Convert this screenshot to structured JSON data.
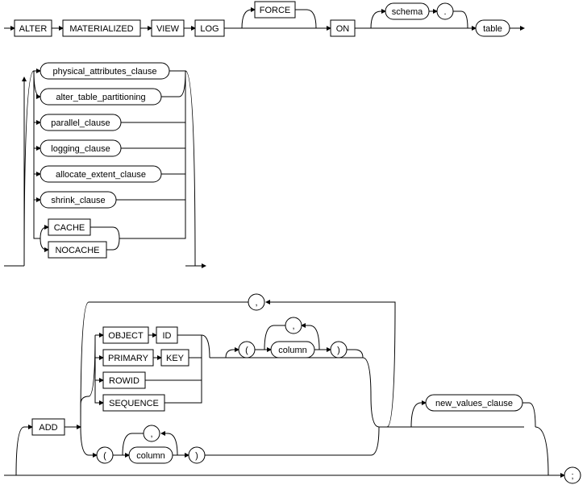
{
  "row1": {
    "alter": "ALTER",
    "materialized": "MATERIALIZED",
    "view": "VIEW",
    "log": "LOG",
    "force": "FORCE",
    "on": "ON",
    "schema": "schema",
    "dot": ".",
    "table": "table"
  },
  "block2": {
    "physical_attributes_clause": "physical_attributes_clause",
    "alter_table_partitioning": "alter_table_partitioning",
    "parallel_clause": "parallel_clause",
    "logging_clause": "logging_clause",
    "allocate_extent_clause": "allocate_extent_clause",
    "shrink_clause": "shrink_clause",
    "cache": "CACHE",
    "nocache": "NOCACHE"
  },
  "block3": {
    "add": "ADD",
    "object": "OBJECT",
    "id": "ID",
    "primary": "PRIMARY",
    "key": "KEY",
    "rowid": "ROWID",
    "sequence": "SEQUENCE",
    "lparen1": "(",
    "column1": "column",
    "rparen1": ")",
    "comma_col1": ",",
    "lparen2": "(",
    "column2": "column",
    "rparen2": ")",
    "comma_col2": ",",
    "comma_top": ",",
    "new_values_clause": "new_values_clause",
    "semicolon": ";"
  }
}
